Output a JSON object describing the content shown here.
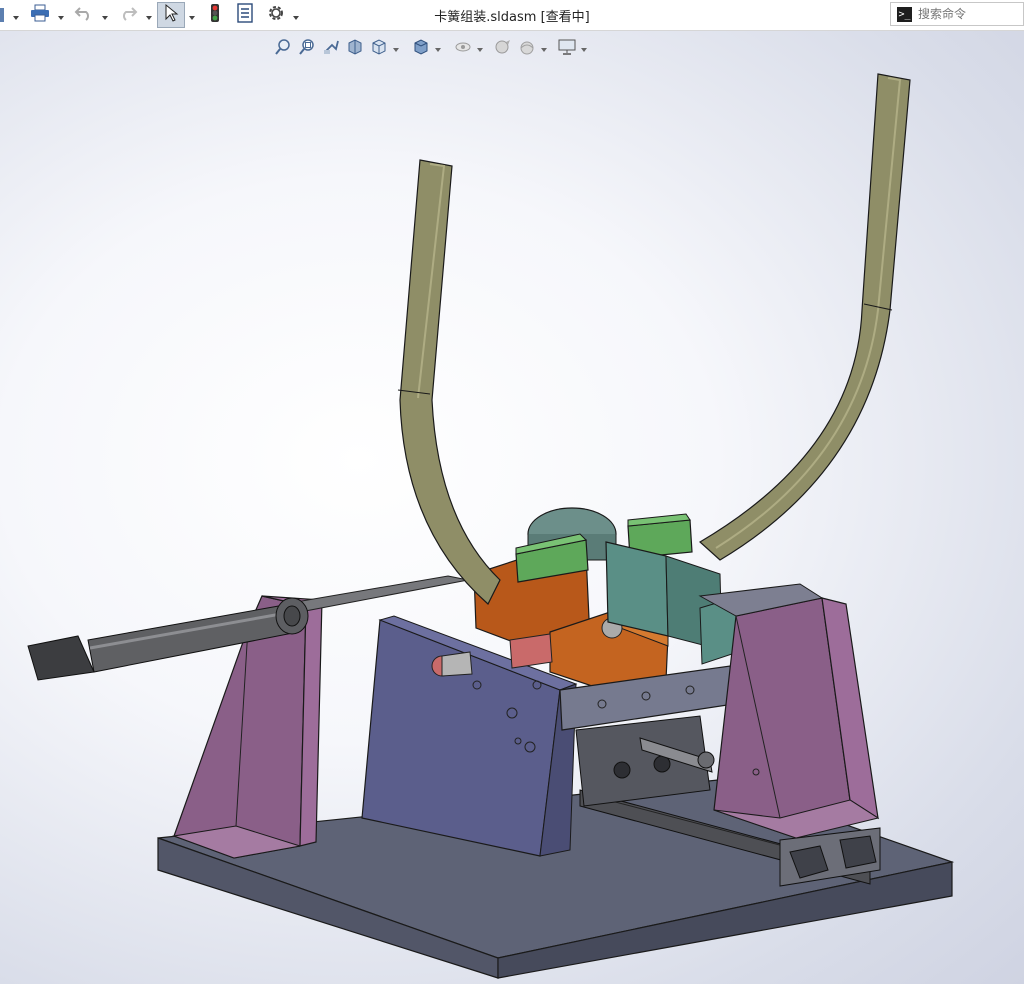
{
  "window": {
    "title": "卡簧组装.sldasm [查看中]"
  },
  "toolbar": {
    "items": [
      {
        "name": "print",
        "icon": "printer-icon"
      },
      {
        "name": "undo",
        "icon": "undo-icon"
      },
      {
        "name": "redo",
        "icon": "redo-icon"
      },
      {
        "name": "select",
        "icon": "cursor-arrow-icon"
      },
      {
        "name": "rebuild",
        "icon": "traffic-light-icon"
      },
      {
        "name": "file-properties",
        "icon": "file-properties-icon"
      },
      {
        "name": "options",
        "icon": "gear-icon"
      }
    ]
  },
  "search": {
    "placeholder": "搜索命令",
    "value": ""
  },
  "heads_up_toolbar": {
    "items": [
      {
        "name": "zoom-to-fit",
        "icon": "zoom-fit-icon"
      },
      {
        "name": "zoom-to-area",
        "icon": "zoom-area-icon"
      },
      {
        "name": "previous-view",
        "icon": "previous-view-icon"
      },
      {
        "name": "section-view",
        "icon": "section-view-icon"
      },
      {
        "name": "view-orientation",
        "icon": "view-orientation-icon"
      },
      {
        "name": "display-style",
        "icon": "display-style-icon"
      },
      {
        "name": "hide-show-items",
        "icon": "hide-show-icon"
      },
      {
        "name": "edit-appearance",
        "icon": "appearance-icon"
      },
      {
        "name": "apply-scene",
        "icon": "scene-icon"
      },
      {
        "name": "view-settings",
        "icon": "monitor-icon"
      }
    ]
  },
  "colors": {
    "base_plate": "#5e6376",
    "side_plate": "#5b5e8c",
    "brackets": "#8a5f88",
    "rails": "#8f8e67",
    "orange_blocks": "#b8581a",
    "green_blocks": "#5ea85a",
    "teal_blocks": "#5a8f86",
    "cylinder": "#5f6063",
    "background_top": "#ffffff",
    "background_edge": "#cfd3e2"
  }
}
